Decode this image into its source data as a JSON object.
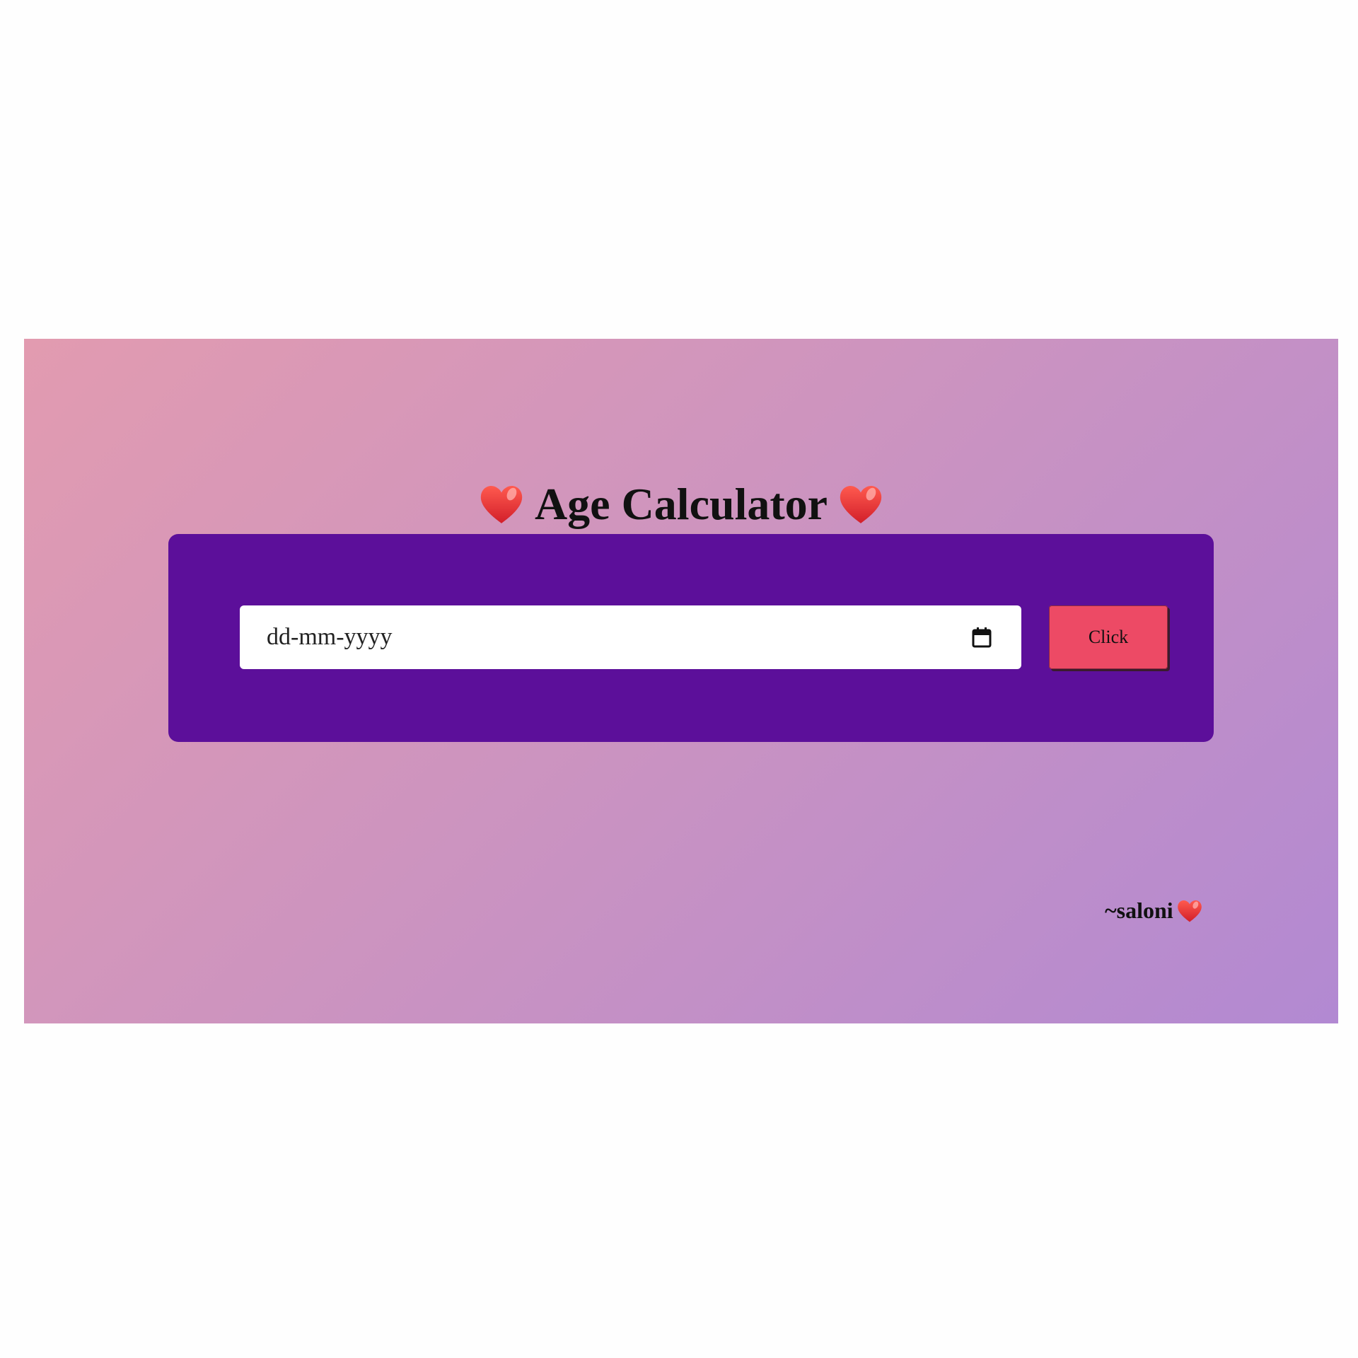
{
  "page": {
    "title": "Age Calculator",
    "title_icon_left": "heart-icon",
    "title_icon_right": "heart-icon"
  },
  "form": {
    "date_placeholder": "dd-mm-yyyy",
    "date_icon": "calendar-icon",
    "button_label": "Click"
  },
  "footer": {
    "signature": "~saloni",
    "signature_icon": "heart-icon"
  },
  "colors": {
    "card": "#5c0f9a",
    "button": "#ed4a65",
    "background_start": "#e29bb0",
    "background_end": "#b289d2",
    "heart": "#f23a3a"
  }
}
